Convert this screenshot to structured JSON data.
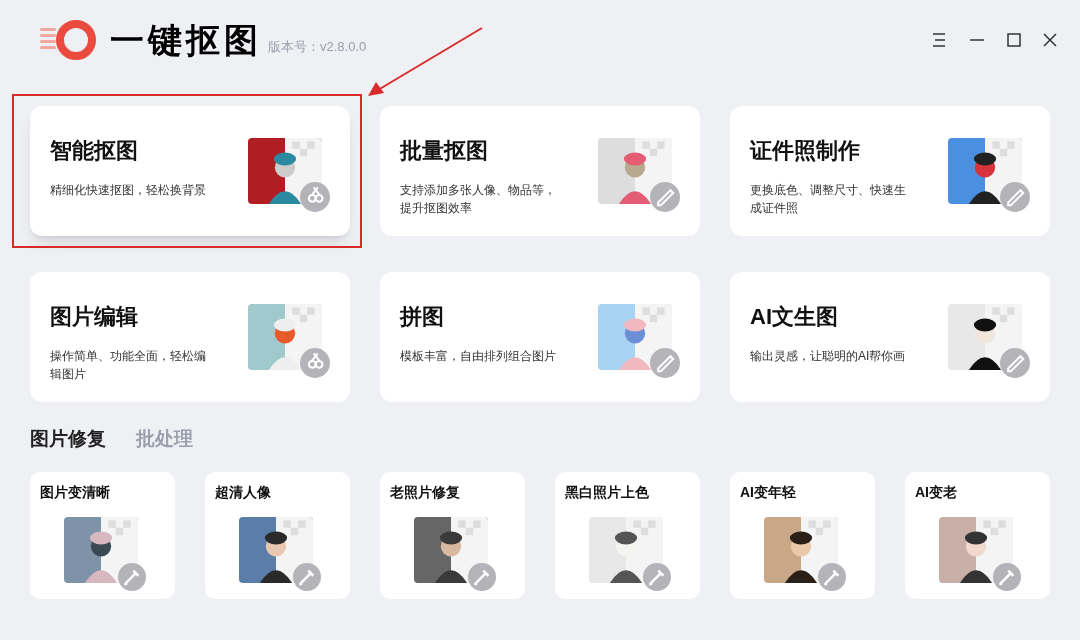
{
  "app": {
    "name": "一键抠图",
    "version": "版本号：v2.8.0.0"
  },
  "feature_cards": [
    {
      "title": "智能抠图",
      "description": "精细化快速抠图，轻松换背景",
      "highlighted": true
    },
    {
      "title": "批量抠图",
      "description": "支持添加多张人像、物品等，提升抠图效率",
      "highlighted": false
    },
    {
      "title": "证件照制作",
      "description": "更换底色、调整尺寸、快速生成证件照",
      "highlighted": false
    },
    {
      "title": "图片编辑",
      "description": "操作简单、功能全面，轻松编辑图片",
      "highlighted": false
    },
    {
      "title": "拼图",
      "description": "模板丰富，自由排列组合图片",
      "highlighted": false
    },
    {
      "title": "AI文生图",
      "description": "输出灵感，让聪明的AI帮你画",
      "highlighted": false
    }
  ],
  "tabs": [
    {
      "label": "图片修复",
      "selected": true
    },
    {
      "label": "批处理",
      "selected": false
    }
  ],
  "tools": [
    {
      "title": "图片变清晰"
    },
    {
      "title": "超清人像"
    },
    {
      "title": "老照片修复"
    },
    {
      "title": "黑白照片上色"
    },
    {
      "title": "AI变年轻"
    },
    {
      "title": "AI变老"
    }
  ]
}
